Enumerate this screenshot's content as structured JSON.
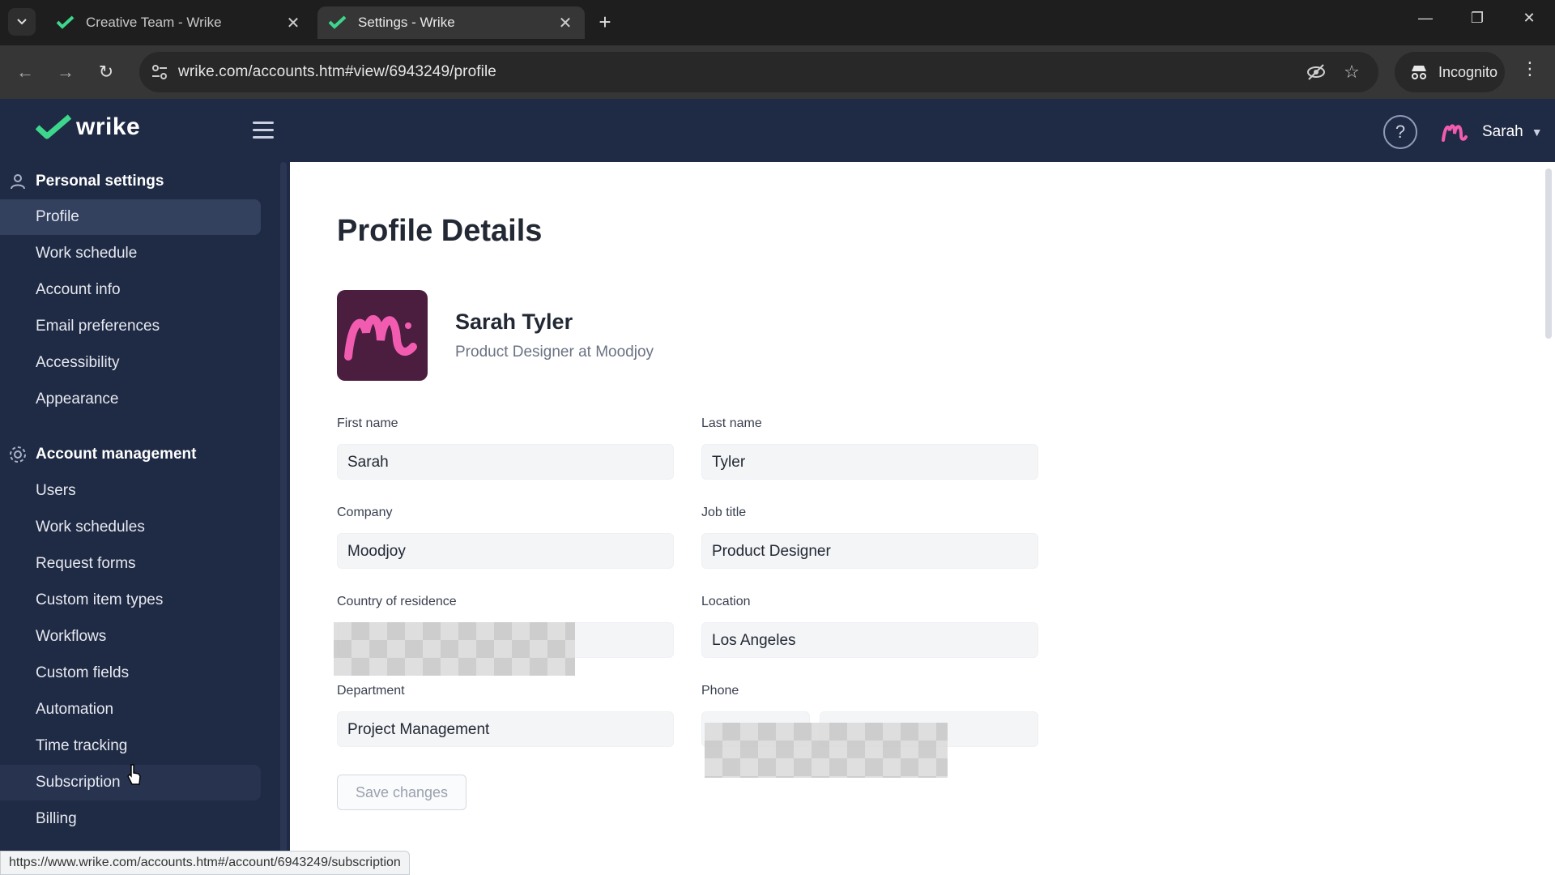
{
  "browser": {
    "tabs": [
      {
        "title": "Creative Team - Wrike",
        "active": false
      },
      {
        "title": "Settings - Wrike",
        "active": true
      }
    ],
    "url": "wrike.com/accounts.htm#view/6943249/profile",
    "incognito_label": "Incognito",
    "status_url": "https://www.wrike.com/accounts.htm#/account/6943249/subscription"
  },
  "header": {
    "logo_text": "wrike",
    "user_name": "Sarah"
  },
  "sidebar": {
    "personal_title": "Personal settings",
    "personal_items": [
      "Profile",
      "Work schedule",
      "Account info",
      "Email preferences",
      "Accessibility",
      "Appearance"
    ],
    "account_title": "Account management",
    "account_items": [
      "Users",
      "Work schedules",
      "Request forms",
      "Custom item types",
      "Workflows",
      "Custom fields",
      "Automation",
      "Time tracking",
      "Subscription",
      "Billing"
    ],
    "active_item": "Profile"
  },
  "profile": {
    "page_title": "Profile Details",
    "full_name": "Sarah Tyler",
    "subtitle": "Product Designer at Moodjoy",
    "labels": {
      "first_name": "First name",
      "last_name": "Last name",
      "company": "Company",
      "job_title": "Job title",
      "country": "Country of residence",
      "location": "Location",
      "department": "Department",
      "phone": "Phone"
    },
    "values": {
      "first_name": "Sarah",
      "last_name": "Tyler",
      "company": "Moodjoy",
      "job_title": "Product Designer",
      "country": "",
      "location": "Los Angeles",
      "department": "Project Management",
      "phone": ""
    },
    "save_label": "Save changes"
  },
  "colors": {
    "brand_green": "#3dd68c",
    "nav_bg": "#1f2a44",
    "avatar_bg": "#4b1d3f",
    "avatar_accent": "#f25cb0"
  }
}
